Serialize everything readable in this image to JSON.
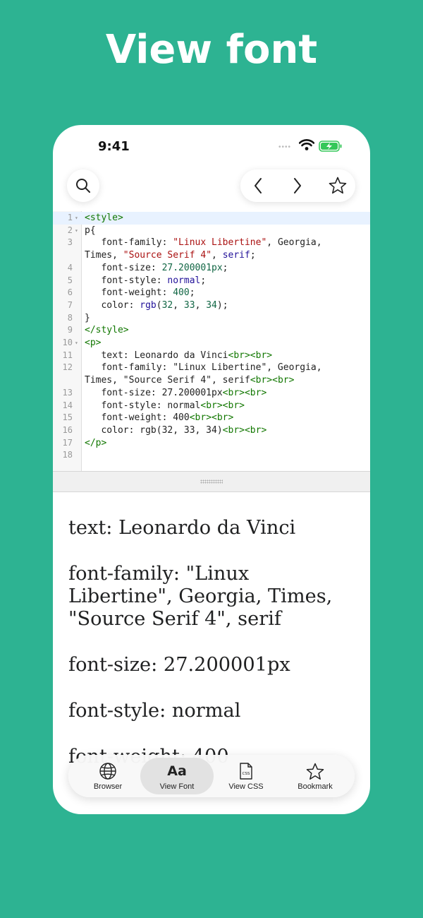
{
  "headline": "View font",
  "status_bar": {
    "time": "9:41",
    "signal_dots": "••••"
  },
  "editor": {
    "lines": [
      {
        "n": "1",
        "fold": "▾",
        "html": "<span class='tag'>&lt;style&gt;</span>"
      },
      {
        "n": "2",
        "fold": "▾",
        "html": "p{"
      },
      {
        "n": "3",
        "fold": "",
        "html": "   font-family: <span class='str'>\"Linux Libertine\"</span>, Georgia,"
      },
      {
        "n": "",
        "fold": "",
        "html": "Times, <span class='str'>\"Source Serif 4\"</span>, <span class='kw'>serif</span>;"
      },
      {
        "n": "4",
        "fold": "",
        "html": "   font-size: <span class='num'>27.200001px</span>;"
      },
      {
        "n": "5",
        "fold": "",
        "html": "   font-style: <span class='kw'>normal</span>;"
      },
      {
        "n": "6",
        "fold": "",
        "html": "   font-weight: <span class='num'>400</span>;"
      },
      {
        "n": "7",
        "fold": "",
        "html": "   color: <span class='kw'>rgb</span>(<span class='num'>32</span>, <span class='num'>33</span>, <span class='num'>34</span>);"
      },
      {
        "n": "8",
        "fold": "",
        "html": "}"
      },
      {
        "n": "9",
        "fold": "",
        "html": "<span class='tag'>&lt;/style&gt;</span>"
      },
      {
        "n": "10",
        "fold": "▾",
        "html": "<span class='tag'>&lt;p&gt;</span>"
      },
      {
        "n": "11",
        "fold": "",
        "html": "   text: Leonardo da Vinci<span class='tag'>&lt;br&gt;&lt;br&gt;</span>"
      },
      {
        "n": "12",
        "fold": "",
        "html": "   font-family: \"Linux Libertine\", Georgia,"
      },
      {
        "n": "",
        "fold": "",
        "html": "Times, \"Source Serif 4\", serif<span class='tag'>&lt;br&gt;&lt;br&gt;</span>"
      },
      {
        "n": "13",
        "fold": "",
        "html": "   font-size: 27.200001px<span class='tag'>&lt;br&gt;&lt;br&gt;</span>"
      },
      {
        "n": "14",
        "fold": "",
        "html": "   font-style: normal<span class='tag'>&lt;br&gt;&lt;br&gt;</span>"
      },
      {
        "n": "15",
        "fold": "",
        "html": "   font-weight: 400<span class='tag'>&lt;br&gt;&lt;br&gt;</span>"
      },
      {
        "n": "16",
        "fold": "",
        "html": "   color: rgb(32, 33, 34)<span class='tag'>&lt;br&gt;&lt;br&gt;</span>"
      },
      {
        "n": "17",
        "fold": "",
        "html": "<span class='tag'>&lt;/p&gt;</span>"
      },
      {
        "n": "18",
        "fold": "",
        "html": ""
      }
    ],
    "colors": {
      "tag": "#117700",
      "string": "#aa1111",
      "keyword": "#221199",
      "number": "#116644"
    }
  },
  "preview": {
    "paragraphs": [
      "text: Leonardo da Vinci",
      "font-family: \"Linux Libertine\", Georgia, Times, \"Source Serif 4\", serif",
      "font-size: 27.200001px",
      "font-style: normal",
      "font-weight: 400"
    ]
  },
  "tab_bar": {
    "tabs": [
      {
        "label": "Browser",
        "icon": "globe-icon"
      },
      {
        "label": "View Font",
        "icon": "font-aa-icon",
        "glyph": "Aa",
        "selected": true
      },
      {
        "label": "View CSS",
        "icon": "css-file-icon"
      },
      {
        "label": "Bookmark",
        "icon": "star-icon"
      }
    ]
  },
  "theme": {
    "background": "#2db392",
    "battery": "#34c759"
  }
}
